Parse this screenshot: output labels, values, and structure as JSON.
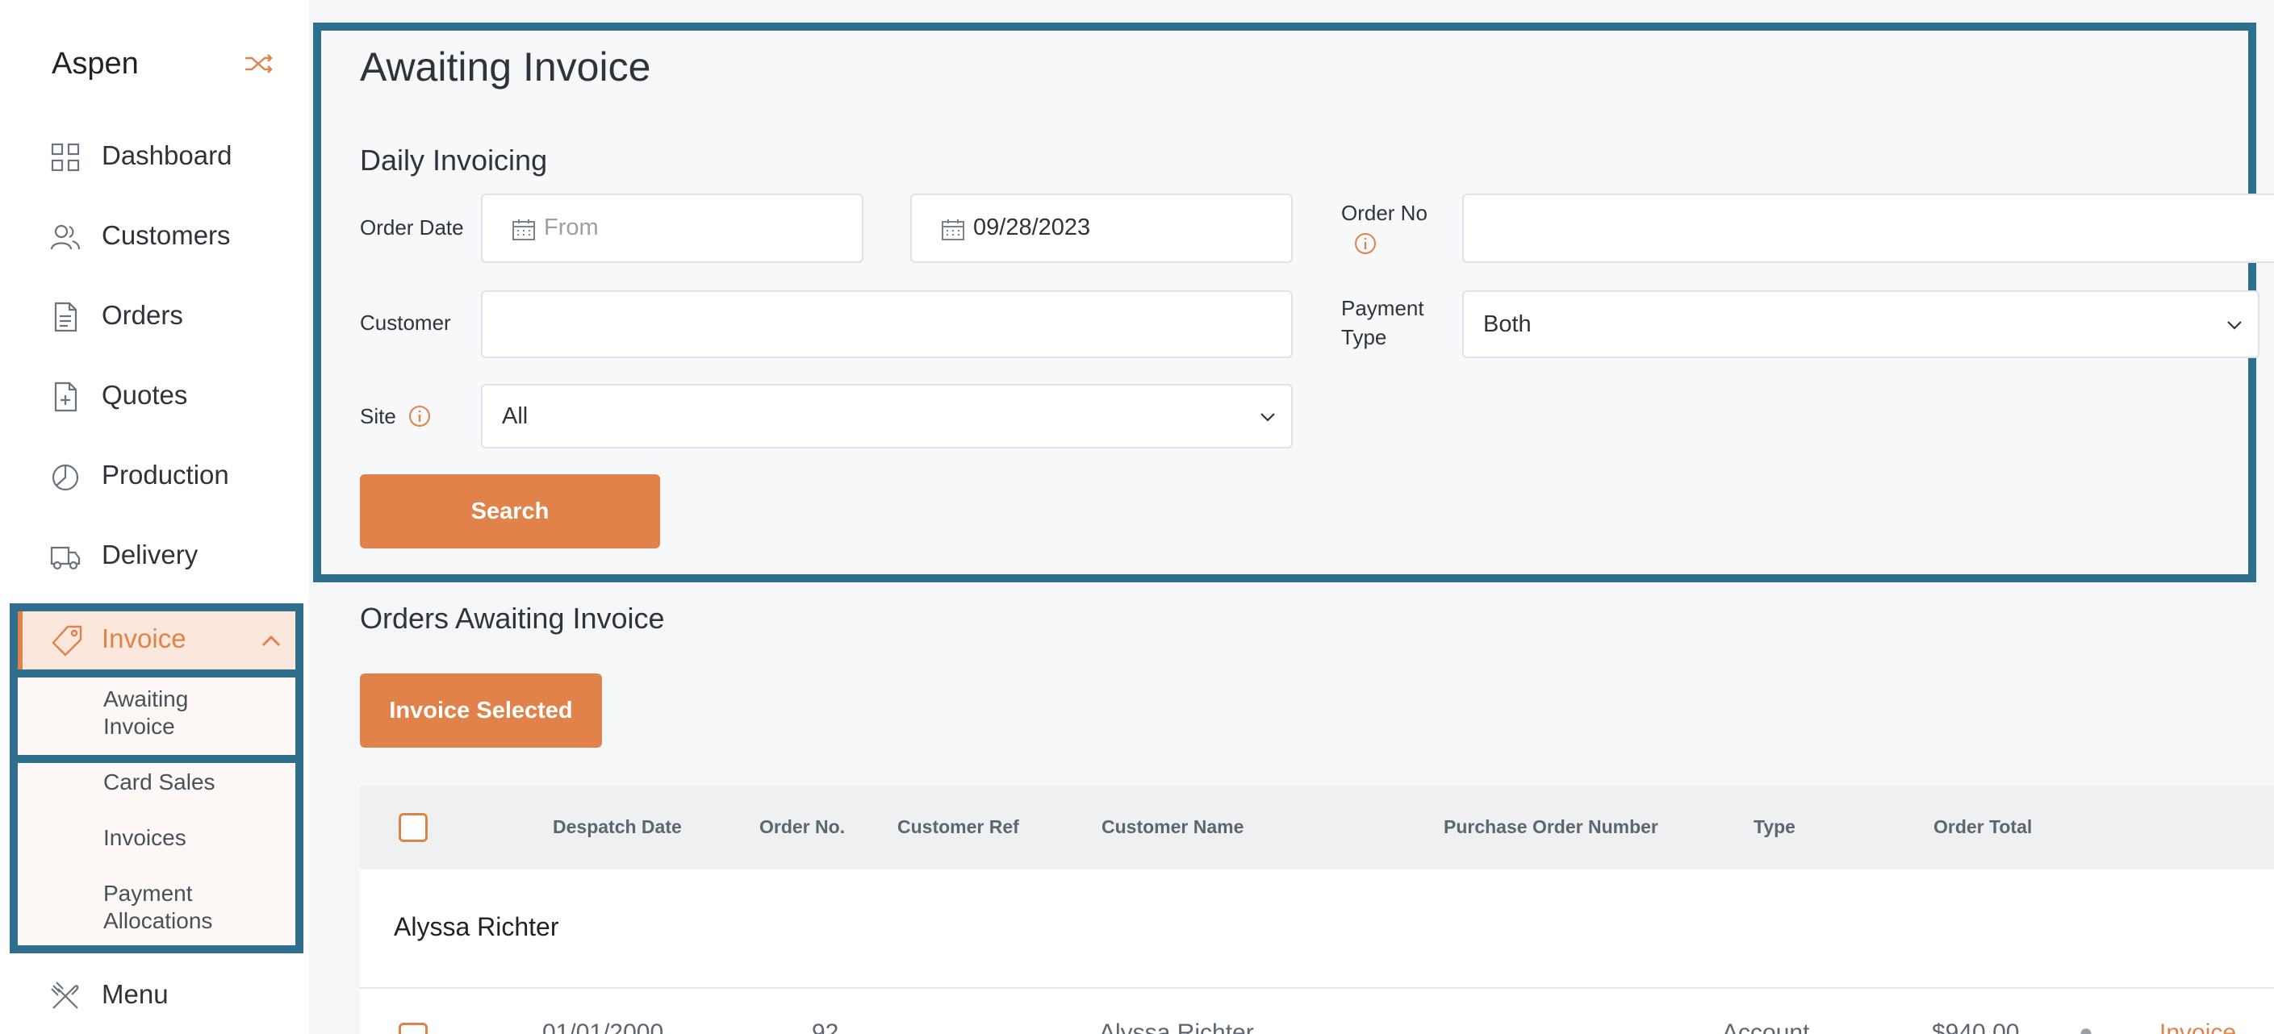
{
  "sidebar": {
    "brand": "Aspen",
    "items": [
      {
        "label": "Dashboard",
        "icon": "grid-icon"
      },
      {
        "label": "Customers",
        "icon": "users-icon"
      },
      {
        "label": "Orders",
        "icon": "document-icon"
      },
      {
        "label": "Quotes",
        "icon": "document-plus-icon"
      },
      {
        "label": "Production",
        "icon": "pie-chart-icon"
      },
      {
        "label": "Delivery",
        "icon": "truck-icon"
      }
    ],
    "invoice": {
      "label": "Invoice",
      "icon": "tag-icon",
      "subitems": [
        {
          "line1": "Awaiting",
          "line2": "Invoice"
        },
        {
          "line1": "Card Sales",
          "line2": ""
        },
        {
          "line1": "Invoices",
          "line2": ""
        },
        {
          "line1": "Payment",
          "line2": "Allocations"
        }
      ]
    },
    "menu": {
      "label": "Menu",
      "icon": "utensils-icon"
    }
  },
  "page": {
    "title": "Awaiting Invoice"
  },
  "filters": {
    "section_title": "Daily Invoicing",
    "order_date_label": "Order Date",
    "from_placeholder": "From",
    "to_value": "09/28/2023",
    "order_no_label": "Order No",
    "order_no_value": "",
    "customer_label": "Customer",
    "customer_value": "",
    "payment_type_label_1": "Payment",
    "payment_type_label_2": "Type",
    "payment_type_value": "Both",
    "site_label": "Site",
    "site_value": "All",
    "search_label": "Search"
  },
  "orders": {
    "title": "Orders Awaiting Invoice",
    "invoice_selected_label": "Invoice Selected",
    "columns": [
      "Despatch Date",
      "Order No.",
      "Customer Ref",
      "Customer Name",
      "Purchase Order Number",
      "Type",
      "Order Total"
    ],
    "groups": [
      {
        "name": "Alyssa Richter",
        "rows": [
          {
            "despatch_date": "01/01/2000",
            "order_no": "92",
            "customer_ref": "",
            "customer_name": "Alyssa Richter",
            "po_number": "",
            "type": "Account",
            "order_total": "$940.00",
            "action": "Invoice"
          }
        ]
      }
    ]
  },
  "colors": {
    "accent": "#e0824a",
    "highlight_border": "#2e6f8e"
  }
}
